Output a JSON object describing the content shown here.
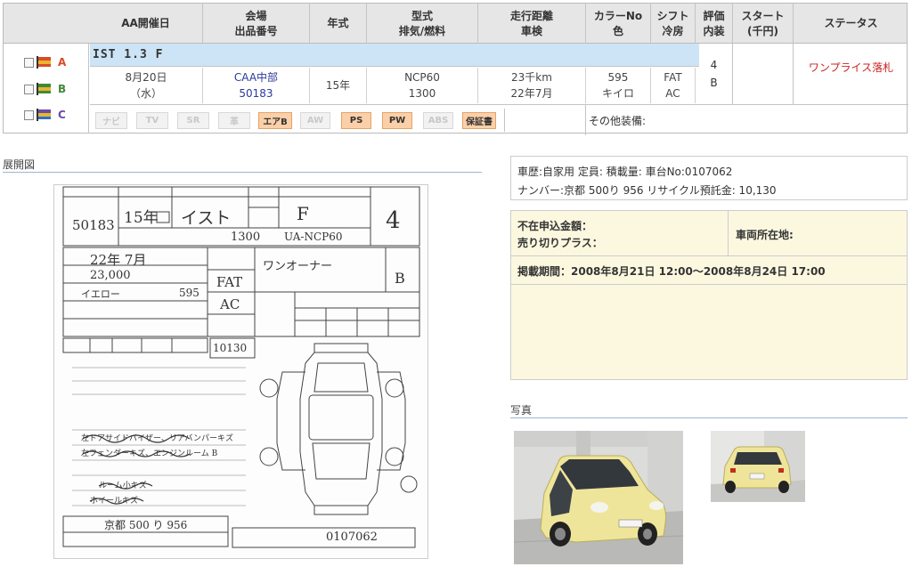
{
  "header": {
    "columns": [
      "AA開催日",
      "会場\n出品番号",
      "年式",
      "型式\n排気/燃料",
      "走行距離\n車検",
      "カラーNo\n色",
      "シフト\n冷房",
      "評価\n内装",
      "スタート\n(千円)",
      "ステータス"
    ]
  },
  "flags": [
    {
      "label": "A",
      "colors": [
        "#d94a2a",
        "#e8b52c",
        "#d94a2a"
      ]
    },
    {
      "label": "B",
      "colors": [
        "#3f8a3a",
        "#e8b52c",
        "#3f8a3a"
      ]
    },
    {
      "label": "C",
      "colors": [
        "#6a4aa8",
        "#e8b52c",
        "#2a70c8"
      ]
    }
  ],
  "listing": {
    "model": "IST 1.3 F",
    "date": "8月20日\n（水）",
    "venue": "CAA中部\n50183",
    "year": "15年",
    "type": "NCP60\n1300",
    "mileage": "23千km\n22年7月",
    "color": "595\nキイロ",
    "shift": "FAT\nAC",
    "grade": "4",
    "interior": "B",
    "start": "",
    "status": "ワンプライス落札"
  },
  "options": [
    {
      "label": "ナビ",
      "on": false
    },
    {
      "label": "TV",
      "on": false
    },
    {
      "label": "SR",
      "on": false
    },
    {
      "label": "革",
      "on": false
    },
    {
      "label": "エアB",
      "on": true
    },
    {
      "label": "AW",
      "on": false
    },
    {
      "label": "PS",
      "on": true
    },
    {
      "label": "PW",
      "on": true
    },
    {
      "label": "ABS",
      "on": false
    },
    {
      "label": "保証書",
      "on": true
    }
  ],
  "other_equipment_label": "その他装備:",
  "sections": {
    "diagram": "展開図",
    "photos": "写真"
  },
  "sheet": {
    "lot": "50183",
    "year": "15年",
    "name": "イスト",
    "grade": "F",
    "score": "4",
    "displacement": "1300",
    "model_code": "UA-NCP60",
    "inspection": "22年 7月",
    "mileage": "23,000",
    "color_name": "イエロー",
    "color_code": "595",
    "shift": "FAT",
    "ac": "AC",
    "sales_point": "ワンオーナー",
    "interior": "B",
    "recycle_fee": "10130",
    "plate": "京都 500 り 956",
    "chassis_no": "0107062",
    "note1": "左ドアサイドバイザー、リアバンパーキズ",
    "note2": "左フェンダーキズ、エンジンルーム B",
    "note3": "ルーム小キズ",
    "note4": "ホイールキズ"
  },
  "info1": {
    "line1": "車歴:自家用  定員:       積載量:     車台No:0107062",
    "line2": "ナンバー:京都 500り 956   リサイクル預託金: 10,130"
  },
  "info2": {
    "absent_bid": "不在申込金額：",
    "sell_plus": "売り切りプラス：",
    "location_label": "車両所在地:",
    "period": "掲載期間：2008年8月21日 12:00～2008年8月24日 17:00"
  },
  "colors": {
    "header_bg": "#e6e6e6",
    "model_row_bg": "#cde4f6",
    "option_on_bg": "#fbd0a8",
    "status_red": "#cc2222",
    "info_bg": "#fcf8e0",
    "car_yellow": "#efe59a"
  }
}
